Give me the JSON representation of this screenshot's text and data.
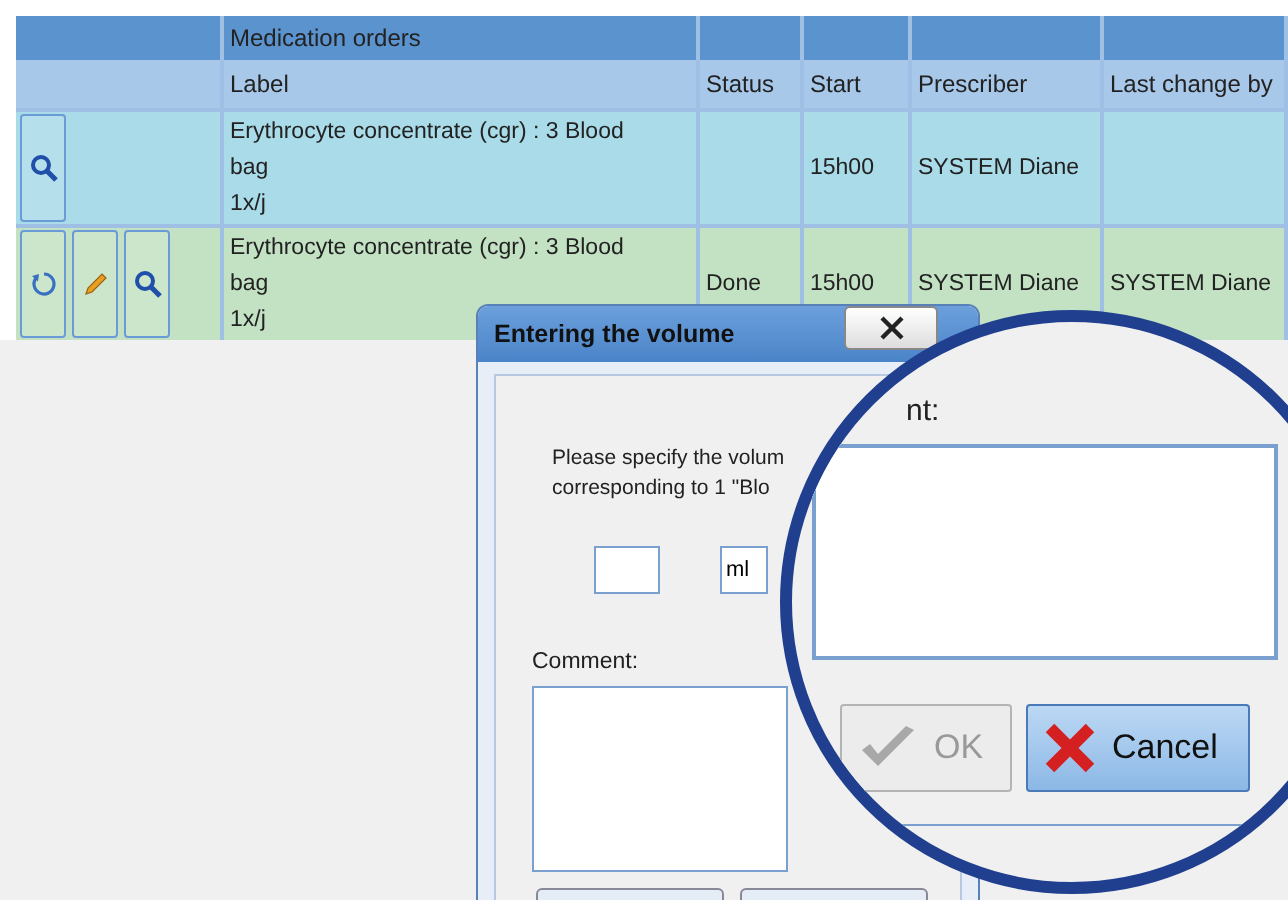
{
  "table": {
    "group_header": "Medication orders",
    "columns": [
      "Label",
      "Status",
      "Start",
      "Prescriber",
      "Last change by"
    ],
    "rows": [
      {
        "color": "#a9dbe8",
        "actions": [
          {
            "kind": "view"
          }
        ],
        "label": [
          "Erythrocyte concentrate (cgr) : 3 Blood",
          "bag",
          "1x/j"
        ],
        "status": "",
        "start": "15h00",
        "prescriber": "SYSTEM Diane",
        "last_change_by": ""
      },
      {
        "color": "#c3e2c3",
        "actions": [
          {
            "kind": "undo"
          },
          {
            "kind": "edit"
          },
          {
            "kind": "view"
          }
        ],
        "label": [
          "Erythrocyte concentrate (cgr) : 3 Blood",
          "bag",
          "1x/j"
        ],
        "status": "Done",
        "start": "15h00",
        "prescriber": "SYSTEM Diane",
        "last_change_by": "SYSTEM Diane"
      }
    ]
  },
  "dialog": {
    "title": "Entering the volume",
    "message": [
      "Please specify the volum",
      "corresponding to 1 \"Blo"
    ],
    "unit": "ml",
    "comment_label": "Comment:"
  },
  "magnifier": {
    "label": "nt:",
    "ok_button": {
      "label": "OK",
      "disabled": true
    },
    "cancel_button": {
      "label": "Cancel"
    }
  }
}
